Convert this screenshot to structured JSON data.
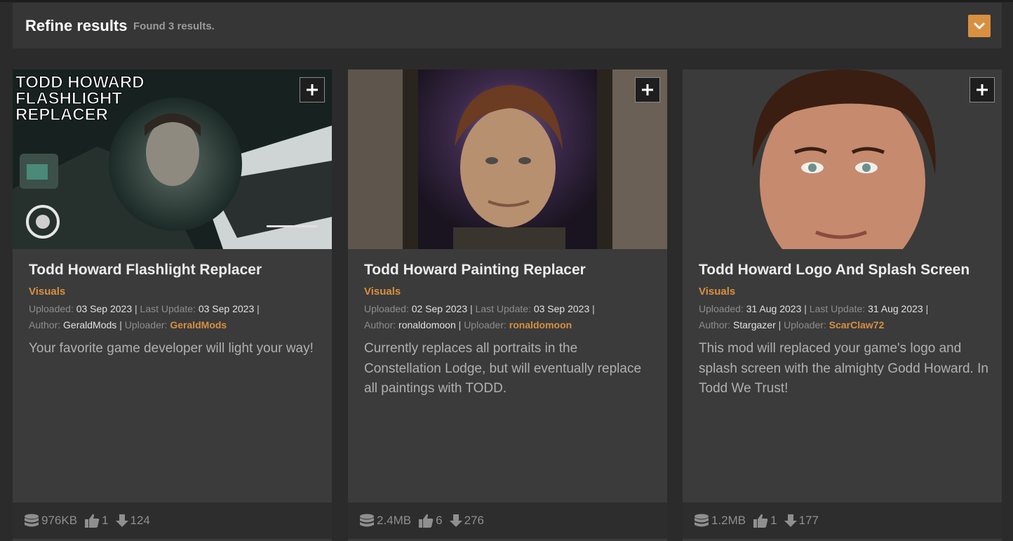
{
  "refine": {
    "title": "Refine results",
    "count": "Found 3 results."
  },
  "colors": {
    "accent": "#d98f40",
    "card_bg": "#3b3b3b",
    "page_bg": "#2b2b2b"
  },
  "cards": [
    {
      "title": "Todd Howard Flashlight Replacer",
      "thumb_text": [
        "TODD HOWARD",
        "FLASHLIGHT",
        "REPLACER"
      ],
      "category": "Visuals",
      "uploaded_label": "Uploaded:",
      "uploaded": "03 Sep 2023",
      "updated_label": "Last Update:",
      "updated": "03 Sep 2023",
      "author_label": "Author:",
      "author": "GeraldMods",
      "uploader_label": "Uploader:",
      "uploader": "GeraldMods",
      "description": "Your favorite game developer will light your way!",
      "size": "976KB",
      "endorsements": "1",
      "downloads": "124"
    },
    {
      "title": "Todd Howard Painting Replacer",
      "category": "Visuals",
      "uploaded_label": "Uploaded:",
      "uploaded": "02 Sep 2023",
      "updated_label": "Last Update:",
      "updated": "03 Sep 2023",
      "author_label": "Author:",
      "author": "ronaldomoon",
      "uploader_label": "Uploader:",
      "uploader": "ronaldomoon",
      "description": "Currently replaces all portraits in the Constellation Lodge, but will eventually replace all paintings with TODD.",
      "size": "2.4MB",
      "endorsements": "6",
      "downloads": "276"
    },
    {
      "title": "Todd Howard Logo And Splash Screen",
      "category": "Visuals",
      "uploaded_label": "Uploaded:",
      "uploaded": "31 Aug 2023",
      "updated_label": "Last Update:",
      "updated": "31 Aug 2023",
      "author_label": "Author:",
      "author": "Stargazer",
      "uploader_label": "Uploader:",
      "uploader": "ScarClaw72",
      "description": "This mod will replaced your game's logo and splash screen with the almighty Godd Howard. In Todd We Trust!",
      "size": "1.2MB",
      "endorsements": "1",
      "downloads": "177"
    }
  ]
}
